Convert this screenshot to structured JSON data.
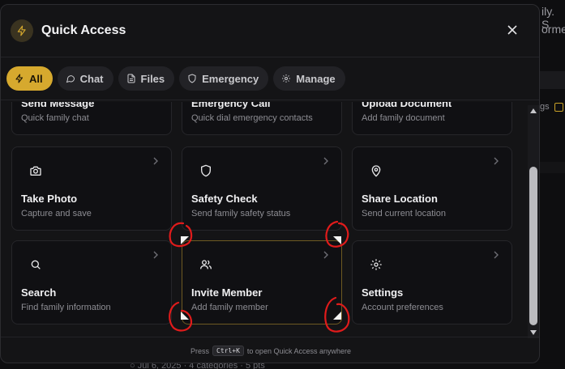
{
  "background": {
    "text1": "ily. S",
    "text2": "orme",
    "small": "gs",
    "bottom": "○ Jul 6, 2025  · 4 categories · 5 pts"
  },
  "modal": {
    "title": "Quick Access",
    "logo_icon": "lightning-icon",
    "close_icon": "close-icon"
  },
  "tabs": [
    {
      "label": "All",
      "icon": "lightning-icon",
      "active": true
    },
    {
      "label": "Chat",
      "icon": "chat-bubble-icon"
    },
    {
      "label": "Files",
      "icon": "document-icon"
    },
    {
      "label": "Emergency",
      "icon": "shield-icon"
    },
    {
      "label": "Manage",
      "icon": "gear-icon"
    }
  ],
  "cards": [
    {
      "title": "Send Message",
      "subtitle": "Quick family chat",
      "icon": "chat-bubble-icon"
    },
    {
      "title": "Emergency Call",
      "subtitle": "Quick dial emergency contacts",
      "icon": "phone-icon"
    },
    {
      "title": "Upload Document",
      "subtitle": "Add family document",
      "icon": "upload-icon"
    },
    {
      "title": "Take Photo",
      "subtitle": "Capture and save",
      "icon": "camera-icon"
    },
    {
      "title": "Safety Check",
      "subtitle": "Send family safety status",
      "icon": "shield-icon"
    },
    {
      "title": "Share Location",
      "subtitle": "Send current location",
      "icon": "location-pin-icon"
    },
    {
      "title": "Search",
      "subtitle": "Find family information",
      "icon": "search-icon"
    },
    {
      "title": "Invite Member",
      "subtitle": "Add family member",
      "icon": "users-icon"
    },
    {
      "title": "Settings",
      "subtitle": "Account preferences",
      "icon": "gear-icon"
    }
  ],
  "footer": {
    "prefix": "Press",
    "shortcut": "Ctrl+K",
    "suffix": "to open Quick Access anywhere"
  },
  "colors": {
    "accent": "#d6a92e",
    "annotation": "#e01b1b"
  }
}
